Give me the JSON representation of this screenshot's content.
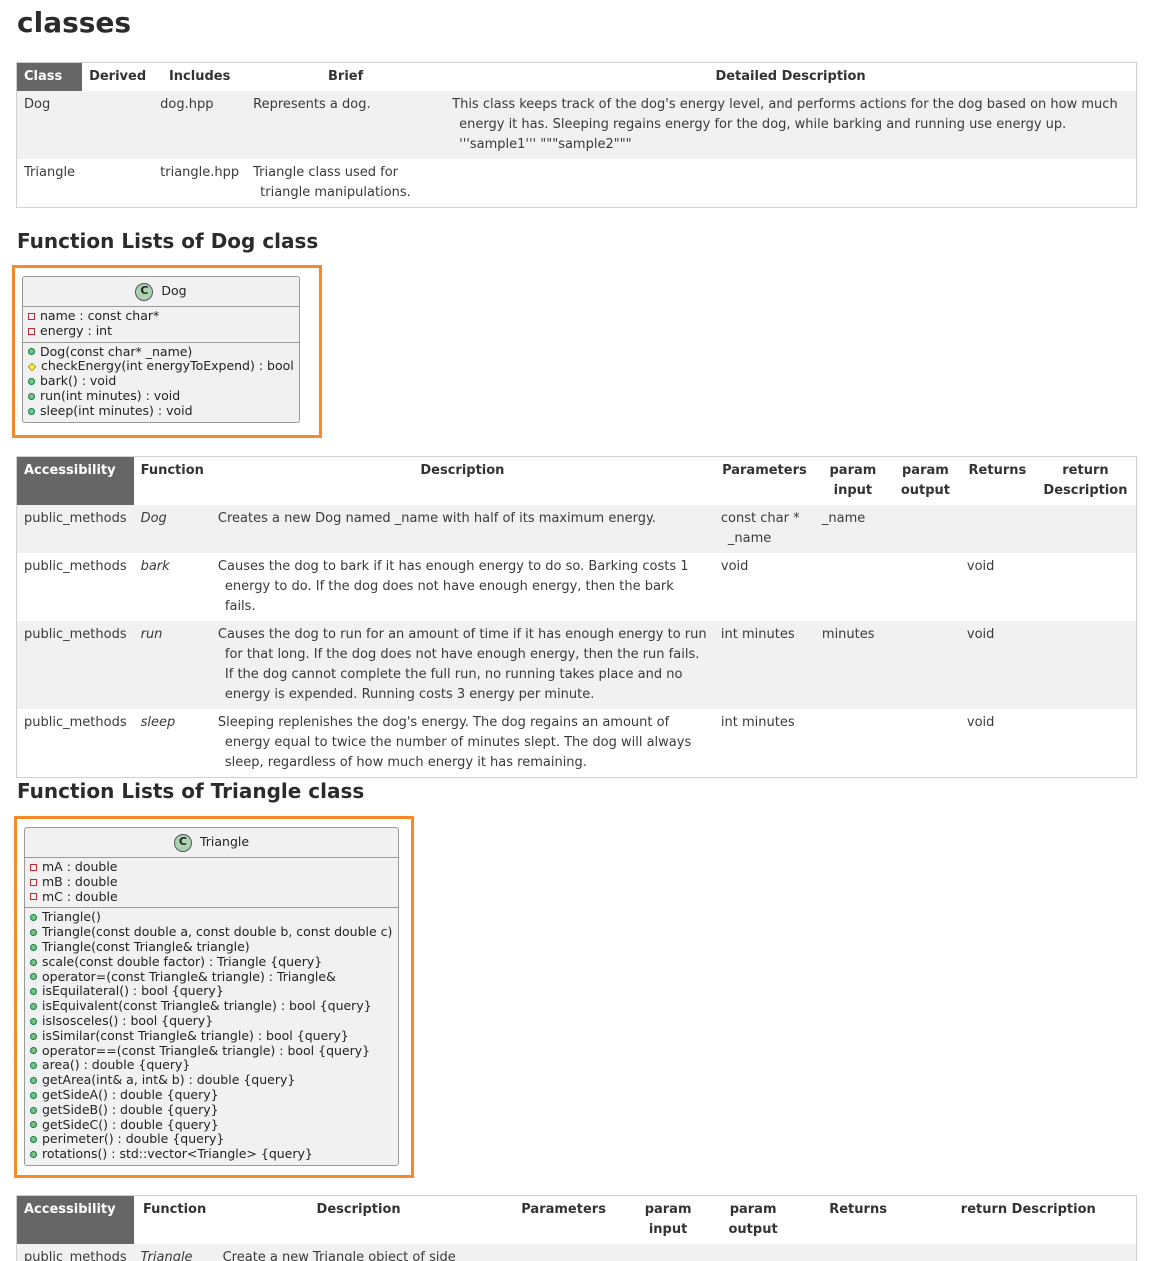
{
  "page_title": "classes",
  "classes_table": {
    "headers": [
      "Class",
      "Derived",
      "Includes",
      "Brief",
      "Detailed Description"
    ],
    "rows": [
      {
        "cls": "Dog",
        "derived": "",
        "includes": "dog.hpp",
        "brief": "Represents a dog.",
        "detail": "This class keeps track of the dog's energy level, and performs actions for the dog based on how much energy it has. Sleeping regains energy for the dog, while barking and running use energy up. '''sample1''' \"\"\"sample2\"\"\""
      },
      {
        "cls": "Triangle",
        "derived": "",
        "includes": "triangle.hpp",
        "brief": "Triangle class used for triangle manipulations.",
        "detail": ""
      }
    ]
  },
  "dog_section": {
    "heading": "Function Lists of Dog class",
    "uml": {
      "icon_letter": "C",
      "name": "Dog",
      "attributes": [
        "name : const char*",
        "energy : int"
      ],
      "methods": [
        {
          "vis": "pub",
          "text": "Dog(const char* _name)"
        },
        {
          "vis": "prot",
          "text": "checkEnergy(int energyToExpend) : bool"
        },
        {
          "vis": "pub",
          "text": "bark() : void"
        },
        {
          "vis": "pub",
          "text": "run(int minutes) : void"
        },
        {
          "vis": "pub",
          "text": "sleep(int minutes) : void"
        }
      ]
    },
    "table": {
      "headers": [
        "Accessibility",
        "Function",
        "Description",
        "Parameters",
        "param input",
        "param output",
        "Returns",
        "return Description"
      ],
      "rows": [
        {
          "acc": "public_methods",
          "fn": "Dog",
          "desc": "Creates a new Dog named _name with half of its maximum energy.",
          "params": "const char * _name",
          "pin": "_name",
          "pout": "",
          "ret": "",
          "retdesc": ""
        },
        {
          "acc": "public_methods",
          "fn": "bark",
          "desc": "Causes the dog to bark if it has enough energy to do so. Barking costs 1 energy to do. If the dog does not have enough energy, then the bark fails.",
          "params": "void",
          "pin": "",
          "pout": "",
          "ret": "void",
          "retdesc": ""
        },
        {
          "acc": "public_methods",
          "fn": "run",
          "desc": "Causes the dog to run for an amount of time if it has enough energy to run for that long. If the dog does not have enough energy, then the run fails. If the dog cannot complete the full run, no running takes place and no energy is expended. Running costs 3 energy per minute.",
          "params": "int minutes",
          "pin": "minutes",
          "pout": "",
          "ret": "void",
          "retdesc": ""
        },
        {
          "acc": "public_methods",
          "fn": "sleep",
          "desc": "Sleeping replenishes the dog's energy. The dog regains an amount of energy equal to twice the number of minutes slept. The dog will always sleep, regardless of how much energy it has remaining.",
          "params": "int minutes",
          "pin": "",
          "pout": "",
          "ret": "void",
          "retdesc": ""
        }
      ]
    }
  },
  "triangle_section": {
    "heading": "Function Lists of Triangle class",
    "uml": {
      "icon_letter": "C",
      "name": "Triangle",
      "attributes": [
        "mA : double",
        "mB : double",
        "mC : double"
      ],
      "methods": [
        "Triangle()",
        "Triangle(const double a, const double b, const double c)",
        "Triangle(const Triangle& triangle)",
        "scale(const double factor) : Triangle {query}",
        "operator=(const Triangle& triangle) : Triangle&",
        "isEquilateral() : bool {query}",
        "isEquivalent(const Triangle& triangle) : bool {query}",
        "isIsosceles() : bool {query}",
        "isSimilar(const Triangle& triangle) : bool {query}",
        "operator==(const Triangle& triangle) : bool {query}",
        "area() : double {query}",
        "getArea(int& a, int& b) : double {query}",
        "getSideA() : double {query}",
        "getSideB() : double {query}",
        "getSideC() : double {query}",
        "perimeter() : double {query}",
        "rotations() : std::vector<Triangle> {query}"
      ]
    },
    "table": {
      "headers": [
        "Accessibility",
        "Function",
        "Description",
        "Parameters",
        "param input",
        "param output",
        "Returns",
        "return Description"
      ],
      "rows": [
        {
          "acc": "public_methods",
          "fn": "Triangle",
          "desc": "Create a new Triangle object of side"
        }
      ]
    }
  }
}
